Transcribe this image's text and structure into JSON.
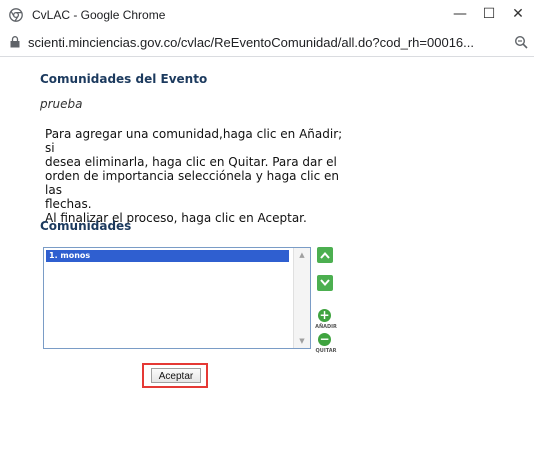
{
  "window": {
    "title": "CvLAC - Google Chrome",
    "minimize_glyph": "—",
    "maximize_glyph": "☐",
    "close_glyph": "✕"
  },
  "address_bar": {
    "url": "scienti.minciencias.gov.co/cvlac/ReEventoComunidad/all.do?cod_rh=00016..."
  },
  "page": {
    "heading": "Comunidades del Evento",
    "event_name": "prueba",
    "instructions": [
      "Para agregar una comunidad,haga clic en Añadir; si",
      "desea eliminarla, haga clic en Quitar. Para dar el",
      "orden de importancia selecciónela y haga clic en las",
      "flechas.",
      "Al finalizar el proceso, haga clic en Aceptar."
    ],
    "list_heading": "Comunidades",
    "list_items": [
      "1. monos"
    ],
    "add_label": "AÑADIR",
    "remove_label": "QUITAR",
    "accept_label": "Aceptar"
  },
  "colors": {
    "heading": "#1c3a5e",
    "selection": "#2f5fd0",
    "action_green": "#4caf50",
    "highlight": "#e53935"
  }
}
